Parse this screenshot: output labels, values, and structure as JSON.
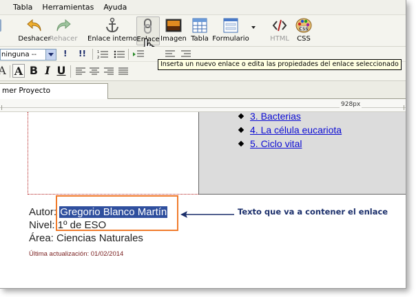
{
  "menubar": {
    "items": [
      "Tabla",
      "Herramientas",
      "Ayuda"
    ]
  },
  "toolbar": {
    "buttons": [
      {
        "label": "Deshacer",
        "icon": "undo-icon"
      },
      {
        "label": "Rehacer",
        "icon": "redo-icon"
      },
      {
        "label": "Enlace interno",
        "icon": "anchor-icon"
      },
      {
        "label": "Enlace",
        "icon": "link-icon"
      },
      {
        "label": "Imagen",
        "icon": "image-icon"
      },
      {
        "label": "Tabla",
        "icon": "table-icon"
      },
      {
        "label": "Formulario",
        "icon": "form-icon"
      },
      {
        "label": "HTML",
        "icon": "html-code-icon"
      },
      {
        "label": "CSS",
        "icon": "css-palette-icon"
      }
    ]
  },
  "format": {
    "block_style_value": "ninguna --",
    "toggle1": "!",
    "toggle2": "!!",
    "bold": "B",
    "italic": "I",
    "underline": "U",
    "font_size_label": "A"
  },
  "tooltip": {
    "text": "Inserta un nuevo enlace o edita las propiedades del enlace seleccionado"
  },
  "tabs": {
    "active": "mer Proyecto"
  },
  "ruler": {
    "width_label": "928px"
  },
  "document": {
    "list_items": [
      "3. Bacterias",
      "4. La célula eucariota",
      "5. Ciclo vital"
    ],
    "author_label": "Autor:",
    "author_name": "Gregorio Blanco Martín",
    "level_label": "Nivel:",
    "level_value": "1º de ESO",
    "area_text": "Área: Ciencias Naturales",
    "updated_text": "Última actualización: 01/02/2014"
  },
  "annotation": {
    "text": "Texto que va a contener el enlace"
  },
  "colors": {
    "selection": "#2f4f9e",
    "highlight_box": "#f07a2a",
    "annotation": "#1b2f6b",
    "link": "#0b0bd3"
  }
}
